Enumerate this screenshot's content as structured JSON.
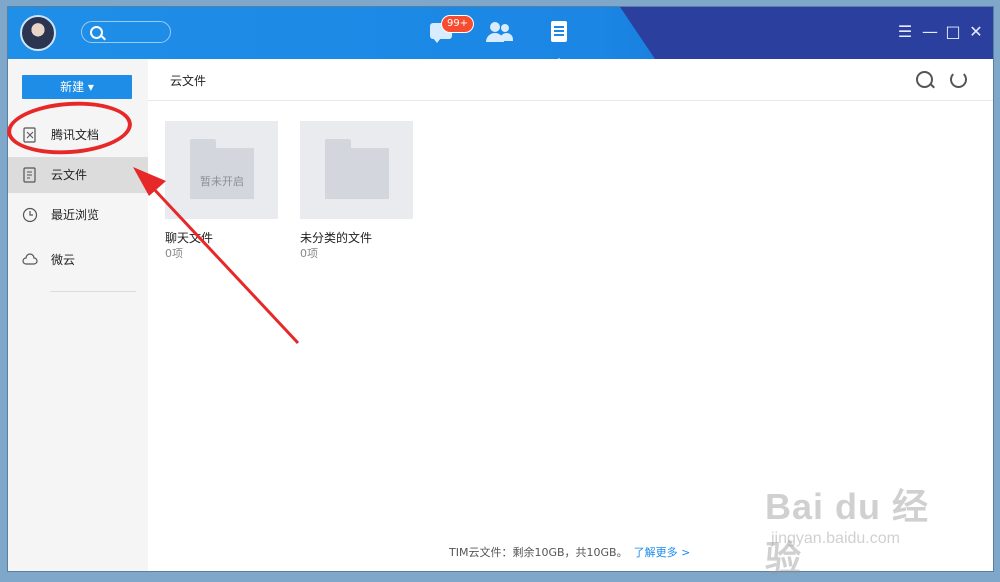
{
  "titlebar": {
    "badge": "99+",
    "tabs": [
      "messages-tab",
      "contacts-tab",
      "files-tab"
    ],
    "window_buttons": [
      "☰",
      "—",
      "□",
      "✕"
    ]
  },
  "sidebar": {
    "new_label": "新建 ▾",
    "items": [
      {
        "label": "腾讯文档",
        "icon": "tencent-docs-icon"
      },
      {
        "label": "云文件",
        "icon": "cloud-file-icon"
      },
      {
        "label": "最近浏览",
        "icon": "clock-icon"
      },
      {
        "label": "微云",
        "icon": "weiyun-cloud-icon"
      }
    ]
  },
  "main": {
    "title": "云文件",
    "folders": [
      {
        "name": "聊天文件",
        "count": "0项",
        "overlay": "暂未开启"
      },
      {
        "name": "未分类的文件",
        "count": "0项",
        "overlay": ""
      }
    ],
    "footer_text": "TIM云文件：剩余10GB，共10GB。",
    "footer_link": "了解更多 >"
  },
  "watermark": {
    "brand": "Bai du 经验",
    "url": "jingyan.baidu.com"
  },
  "colors": {
    "accent": "#1d8de8",
    "annotation": "#e62828"
  }
}
